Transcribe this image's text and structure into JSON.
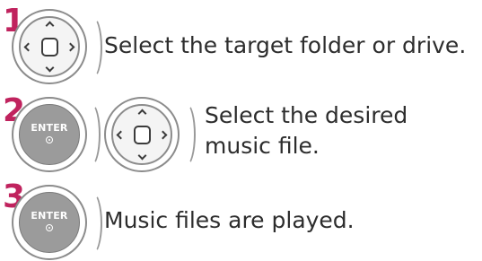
{
  "steps": [
    {
      "number": "1",
      "controls": [
        "navigation-pad"
      ],
      "text": "Select the target folder or drive."
    },
    {
      "number": "2",
      "controls": [
        "enter-button",
        "navigation-pad"
      ],
      "text_line1": "Select the desired",
      "text_line2": "music file."
    },
    {
      "number": "3",
      "controls": [
        "enter-button"
      ],
      "text": "Music files are played."
    }
  ],
  "enter_label": "ENTER",
  "colors": {
    "step_number": "#c0235e",
    "text": "#2d2d2d",
    "button_gray": "#9b9b9b"
  }
}
